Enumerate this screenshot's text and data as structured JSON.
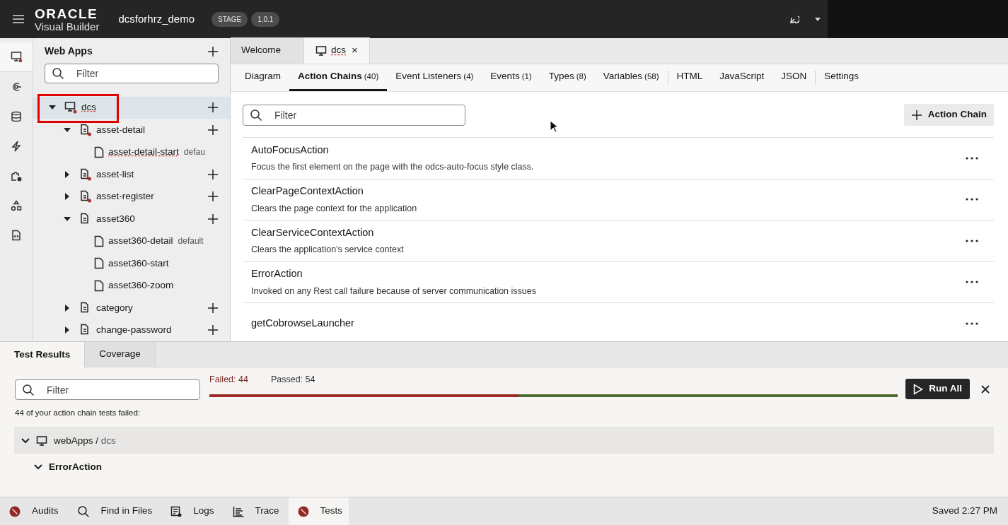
{
  "header": {
    "logo_top": "ORACLE",
    "logo_bottom": "Visual Builder",
    "app_name": "dcsforhrz_demo",
    "badges": [
      "STAGE",
      "1.0.1"
    ]
  },
  "rail": [
    {
      "kind": "monitor",
      "selected": true
    },
    {
      "kind": "service",
      "selected": false
    },
    {
      "kind": "database",
      "selected": false
    },
    {
      "kind": "bolt",
      "selected": false
    },
    {
      "kind": "puzzle",
      "selected": false
    },
    {
      "kind": "shapes",
      "selected": false
    },
    {
      "kind": "code",
      "selected": false
    }
  ],
  "navigator": {
    "title": "Web Apps",
    "filter_placeholder": "Filter",
    "tree": [
      {
        "label": "dcs",
        "kind": "app",
        "selected": true,
        "expanded": true,
        "highlighted": true,
        "children": [
          {
            "label": "asset-detail",
            "kind": "flow",
            "selected": false,
            "error": true,
            "expanded": true,
            "children": [
              {
                "label": "asset-detail-start",
                "kind": "page",
                "selected": false,
                "note": "defau",
                "misspelled": true
              }
            ]
          },
          {
            "label": "asset-list",
            "kind": "flow",
            "selected": false,
            "error": true,
            "expanded": false
          },
          {
            "label": "asset-register",
            "kind": "flow",
            "selected": false,
            "error": true,
            "expanded": false
          },
          {
            "label": "asset360",
            "kind": "flow",
            "selected": false,
            "error": false,
            "expanded": true,
            "children": [
              {
                "label": "asset360-detail",
                "kind": "page",
                "selected": false,
                "note": "default"
              },
              {
                "label": "asset360-start",
                "kind": "page",
                "selected": false
              },
              {
                "label": "asset360-zoom",
                "kind": "page",
                "selected": false
              }
            ]
          },
          {
            "label": "category",
            "kind": "flow",
            "selected": false,
            "error": false,
            "expanded": false
          },
          {
            "label": "change-password",
            "kind": "flow",
            "selected": false,
            "error": false,
            "expanded": false
          }
        ]
      }
    ]
  },
  "editor_tabs": [
    {
      "label": "Welcome",
      "selected": false
    },
    {
      "label": "dcs",
      "selected": true,
      "closable": "×"
    }
  ],
  "sub_tabs": [
    {
      "label": "Diagram",
      "selected": false,
      "divider_before": false
    },
    {
      "label": "Action Chains",
      "count": "(40)",
      "selected": true,
      "divider_before": false
    },
    {
      "label": "Event Listeners",
      "count": "(4)",
      "selected": false,
      "divider_before": false
    },
    {
      "label": "Events",
      "count": "(1)",
      "selected": false,
      "divider_before": false
    },
    {
      "label": "Types",
      "count": "(8)",
      "selected": false,
      "divider_before": false
    },
    {
      "label": "Variables",
      "count": "(58)",
      "selected": false,
      "divider_before": false
    },
    {
      "label": "HTML",
      "selected": false,
      "divider_before": true
    },
    {
      "label": "JavaScript",
      "selected": false,
      "divider_before": false
    },
    {
      "label": "JSON",
      "selected": false,
      "divider_before": false
    },
    {
      "label": "Settings",
      "selected": false,
      "divider_before": true
    }
  ],
  "action_chains": {
    "filter_placeholder": "Filter",
    "add_button": "Action Chain",
    "items": [
      {
        "name": "AutoFocusAction",
        "description": "Focus the first element on the page with the odcs-auto-focus style class."
      },
      {
        "name": "ClearPageContextAction",
        "description": "Clears the page context for the application"
      },
      {
        "name": "ClearServiceContextAction",
        "description": "Clears the application's service context"
      },
      {
        "name": "ErrorAction",
        "description": "Invoked on any Rest call failure because of server communication issues"
      },
      {
        "name": "getCobrowseLauncher"
      }
    ]
  },
  "test_panel": {
    "tabs": [
      {
        "label": "Test Results",
        "selected": true
      },
      {
        "label": "Coverage",
        "selected": false
      }
    ],
    "filter_placeholder": "Filter",
    "failed": "Failed: 44",
    "passed": "Passed: 54",
    "level": 0.449,
    "run_button": "Run All",
    "message": "44 of your action chain tests failed:",
    "group": {
      "path": "webApps /",
      "leaf": "dcs",
      "expanded": true
    },
    "chain": {
      "label": "ErrorAction",
      "expanded": true
    }
  },
  "status_bar": {
    "items": [
      {
        "label": "Audits",
        "kind": "error",
        "selected": false
      },
      {
        "label": "Find in Files",
        "kind": "search",
        "selected": false
      },
      {
        "label": "Logs",
        "kind": "log",
        "selected": false
      },
      {
        "label": "Trace",
        "kind": "trace",
        "selected": false
      },
      {
        "label": "Tests",
        "kind": "error",
        "selected": true
      }
    ],
    "saved": "Saved 2:27 PM"
  }
}
